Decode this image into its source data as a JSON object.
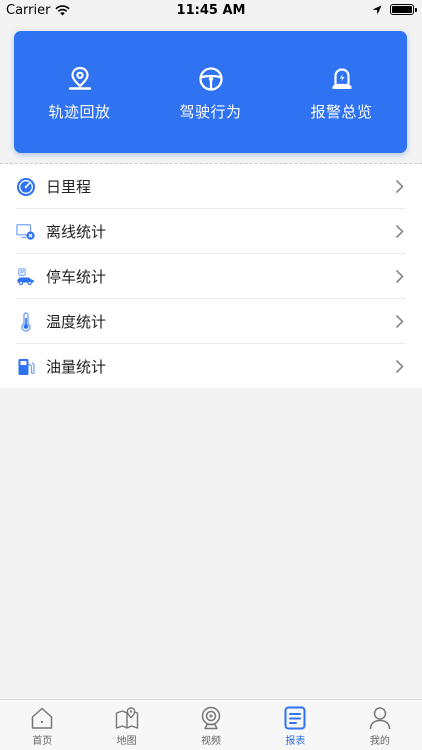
{
  "status_bar": {
    "carrier": "Carrier",
    "time": "11:45 AM"
  },
  "top_actions": [
    {
      "label": "轨迹回放",
      "icon": "location-pin-icon"
    },
    {
      "label": "驾驶行为",
      "icon": "steering-wheel-icon"
    },
    {
      "label": "报警总览",
      "icon": "alarm-light-icon"
    }
  ],
  "menu_items": [
    {
      "label": "日里程",
      "icon": "mileage-gauge-icon"
    },
    {
      "label": "离线统计",
      "icon": "offline-monitor-icon"
    },
    {
      "label": "停车统计",
      "icon": "parking-car-icon"
    },
    {
      "label": "温度统计",
      "icon": "thermometer-icon"
    },
    {
      "label": "油量统计",
      "icon": "fuel-pump-icon"
    }
  ],
  "tabs": [
    {
      "label": "首页",
      "icon": "home-icon",
      "active": false
    },
    {
      "label": "地图",
      "icon": "map-icon",
      "active": false
    },
    {
      "label": "视频",
      "icon": "camera-icon",
      "active": false
    },
    {
      "label": "报表",
      "icon": "report-icon",
      "active": true
    },
    {
      "label": "我的",
      "icon": "profile-icon",
      "active": false
    }
  ],
  "colors": {
    "accent": "#2f72f2",
    "background": "#f3f3f3",
    "inactive_tab": "#666666"
  }
}
